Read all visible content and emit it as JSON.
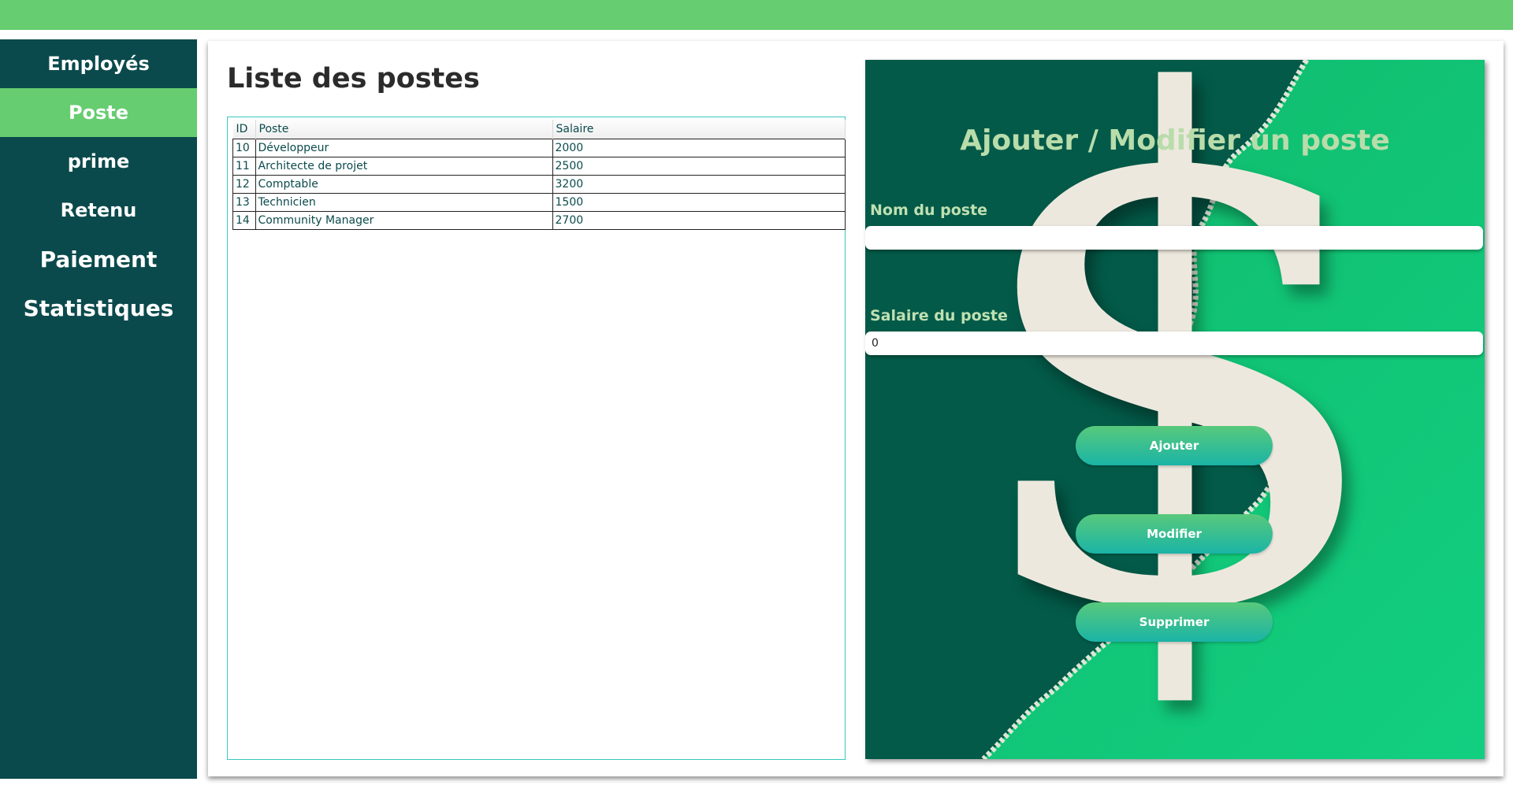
{
  "sidebar": {
    "items": [
      {
        "label": "Employés"
      },
      {
        "label": "Poste"
      },
      {
        "label": "prime"
      },
      {
        "label": "Retenu"
      },
      {
        "label": "Paiement"
      },
      {
        "label": "Statistiques"
      }
    ],
    "active": "Poste"
  },
  "main": {
    "title": "Liste des postes",
    "table": {
      "columns": [
        "ID",
        "Poste",
        "Salaire"
      ],
      "rows": [
        [
          "10",
          "Développeur",
          "2000"
        ],
        [
          "11",
          "Architecte de projet",
          "2500"
        ],
        [
          "12",
          "Comptable",
          "3200"
        ],
        [
          "13",
          "Technicien",
          "1500"
        ],
        [
          "14",
          "Community Manager",
          "2700"
        ]
      ]
    }
  },
  "form": {
    "title": "Ajouter / Modifier un poste",
    "dollar_glyph": "$",
    "name_label": "Nom du poste",
    "name_value": "",
    "salary_label": "Salaire du poste",
    "salary_value": "0",
    "buttons": {
      "add": "Ajouter",
      "edit": "Modifier",
      "delete": "Supprimer"
    }
  },
  "colors": {
    "topbar": "#66cd70",
    "sidebar": "#0b4a4c",
    "active_item": "#66cd70",
    "panel_dark": "#035a48",
    "panel_light": "#12cf80"
  }
}
